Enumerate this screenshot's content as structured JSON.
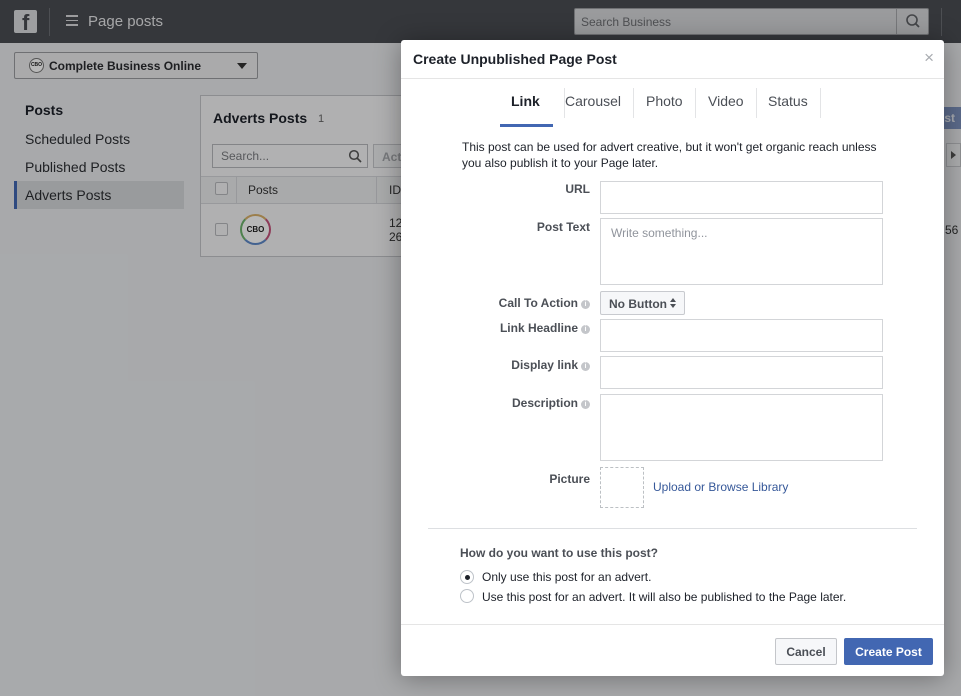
{
  "topbar": {
    "logo_letter": "f",
    "page_title": "Page posts",
    "search_placeholder": "Search Business"
  },
  "page_selector": {
    "page_name": "Complete Business Online",
    "logo_text": "CBO"
  },
  "sidebar": {
    "heading": "Posts",
    "items": [
      {
        "label": "Scheduled Posts",
        "active": false
      },
      {
        "label": "Published Posts",
        "active": false
      },
      {
        "label": "Adverts Posts",
        "active": true
      }
    ]
  },
  "panel": {
    "title": "Adverts Posts",
    "count": "1",
    "search_placeholder": "Search...",
    "actions_label": "Acti",
    "columns": [
      "Posts",
      "ID"
    ],
    "row": {
      "logo_text": "CBO",
      "id_line1": "12",
      "id_line2": "26",
      "trailing_value": "56"
    },
    "right_button_fragment": "ost"
  },
  "modal": {
    "title": "Create Unpublished Page Post",
    "close_label": "×",
    "tabs": [
      {
        "label": "Link",
        "active": true
      },
      {
        "label": "Carousel",
        "active": false
      },
      {
        "label": "Photo",
        "active": false
      },
      {
        "label": "Video",
        "active": false
      },
      {
        "label": "Status",
        "active": false
      }
    ],
    "description": "This post can be used for advert creative, but it won't get organic reach unless you also publish it to your Page later.",
    "fields": {
      "url_label": "URL",
      "url_value": "",
      "post_text_label": "Post Text",
      "post_text_placeholder": "Write something...",
      "cta_label": "Call To Action",
      "cta_value": "No Button",
      "headline_label": "Link Headline",
      "headline_value": "",
      "display_link_label": "Display link",
      "display_link_value": "",
      "description_label": "Description",
      "description_value": "",
      "picture_label": "Picture",
      "upload_link": "Upload or Browse Library"
    },
    "usage": {
      "question": "How do you want to use this post?",
      "options": [
        {
          "label": "Only use this post for an advert.",
          "selected": true
        },
        {
          "label": "Use this post for an advert. It will also be published to the Page later.",
          "selected": false
        }
      ]
    },
    "buttons": {
      "cancel": "Cancel",
      "create": "Create Post"
    }
  },
  "colors": {
    "accent": "#4267b2",
    "link": "#365899",
    "topbar": "#4a4d52"
  }
}
